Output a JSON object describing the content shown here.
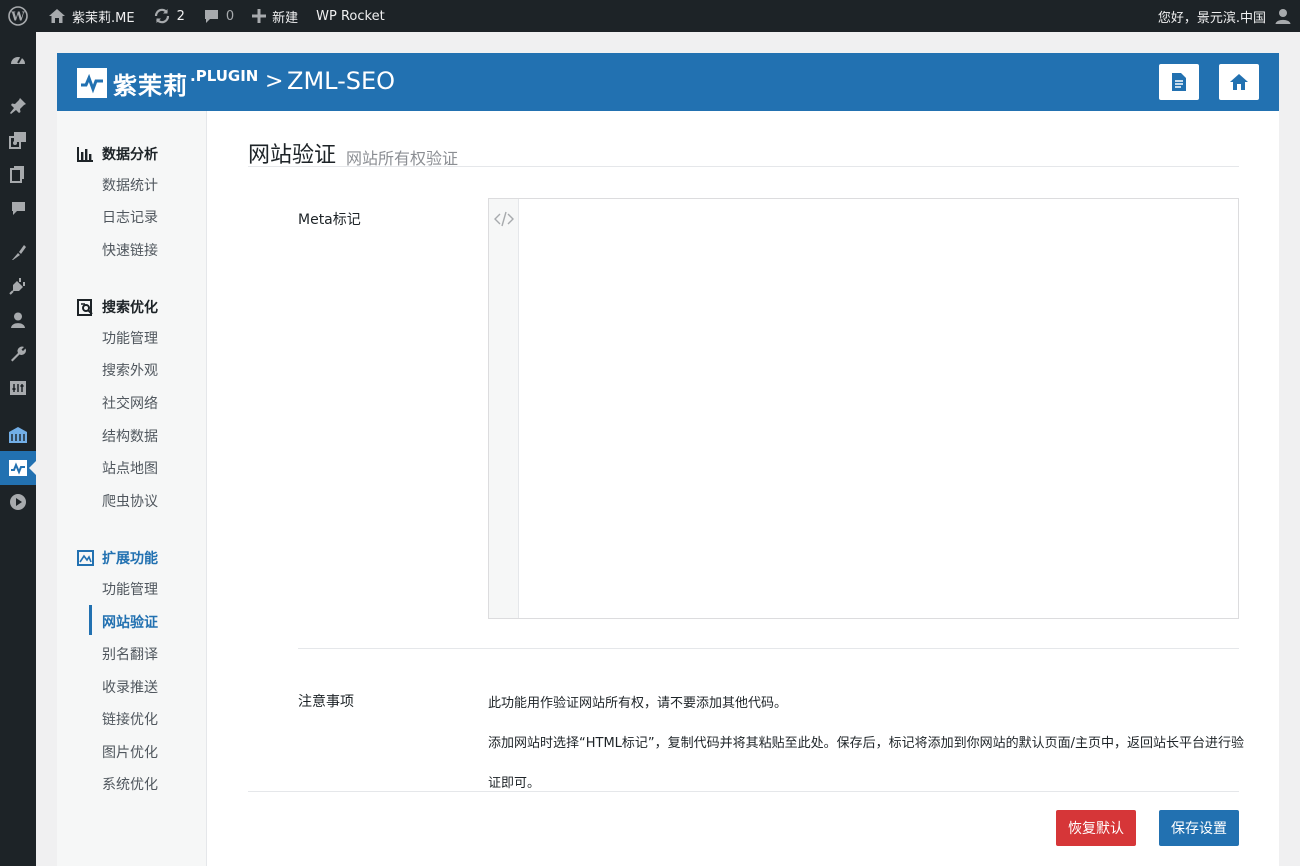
{
  "admin_bar": {
    "site_name": "紫茉莉.ME",
    "updates_count": "2",
    "comments_count": "0",
    "new_label": "新建",
    "plugin_link": "WP Rocket",
    "greeting": "您好，景元滨.中国"
  },
  "admin_menu": {
    "icons": [
      "dashboard-icon",
      "pin-icon",
      "media-icon",
      "pages-icon",
      "comments-icon",
      "appearance-icon",
      "plugins-icon",
      "users-icon",
      "tools-icon",
      "settings-icon",
      "plugin-grid-icon",
      "zml-seo-icon",
      "play-icon"
    ]
  },
  "header": {
    "brand": "紫茉莉",
    "brand_suffix": ".PLUGIN",
    "separator": ">",
    "title": "ZML-SEO",
    "doc_button_icon": "document-icon",
    "home_button_icon": "home-icon"
  },
  "sidebar": {
    "groups": [
      {
        "title": "数据分析",
        "icon": "chart-bars-icon",
        "items": [
          "数据统计",
          "日志记录",
          "快速链接"
        ]
      },
      {
        "title": "搜索优化",
        "icon": "search-doc-icon",
        "items": [
          "功能管理",
          "搜索外观",
          "社交网络",
          "结构数据",
          "站点地图",
          "爬虫协议"
        ]
      },
      {
        "title": "扩展功能",
        "icon": "extension-icon",
        "items": [
          "功能管理",
          "网站验证",
          "别名翻译",
          "收录推送",
          "链接优化",
          "图片优化",
          "系统优化"
        ]
      }
    ],
    "active_item": "网站验证"
  },
  "main": {
    "title": "网站验证",
    "subtitle": "网站所有权验证",
    "meta_label": "Meta标记",
    "meta_value": "",
    "notes_label": "注意事项",
    "note_line1": "此功能用作验证网站所有权，请不要添加其他代码。",
    "note_line2": "添加网站时选择“HTML标记”，复制代码并将其粘贴至此处。保存后，标记将添加到你网站的默认页面/主页中，返回站长平台进行验",
    "note_line3": "证即可。",
    "reset_button": "恢复默认",
    "save_button": "保存设置"
  },
  "colors": {
    "primary": "#2271b1",
    "danger": "#d63638",
    "admin_bar": "#1d2327"
  }
}
